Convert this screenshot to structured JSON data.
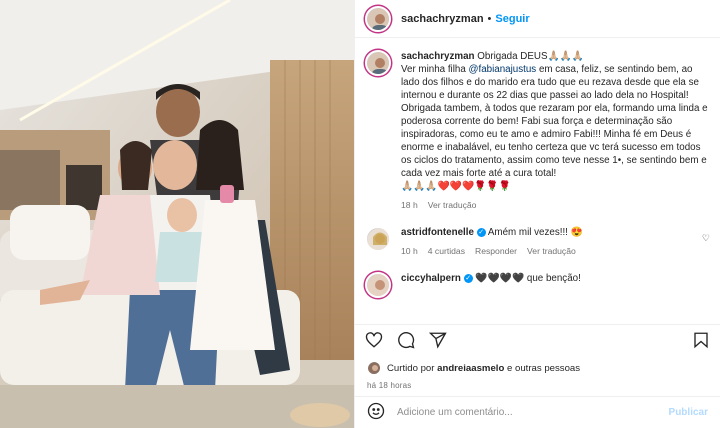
{
  "post": {
    "username": "sachachryzman",
    "separator": "•",
    "follow_label": "Seguir"
  },
  "caption": {
    "username": "sachachryzman",
    "lead": "Obrigada DEUS🙏🏼🙏🏼🙏🏼",
    "p1_before": "Ver minha filha ",
    "mention": "@fabianajustus",
    "p1_after": " em casa, feliz, se sentindo bem, ao lado dos filhos e do marido era tudo que eu rezava desde que ela se internou e durante os 22 dias que passei ao lado dela no Hospital!",
    "p2": "Obrigada tambem, à todos que rezaram por ela, formando uma linda e poderosa corrente do bem! Fabi sua força e determinação são inspiradoras, como eu te amo e admiro Fabi!!! Minha fé em Deus é enorme e inabalável, eu tenho certeza que vc terá sucesso em todos os ciclos do tratamento, assim como teve nesse 1•, se sentindo bem e cada vez mais forte até a cura total!",
    "emojis": "🙏🏼🙏🏼🙏🏼❤️❤️❤️🌹🌹🌹",
    "time": "18 h",
    "translate": "Ver tradução"
  },
  "comments": [
    {
      "username": "astridfontenelle",
      "text": "Amém mil vezes!!! 😍",
      "time": "10 h",
      "likes": "4 curtidas",
      "reply": "Responder",
      "translate": "Ver tradução"
    },
    {
      "username": "ciccyhalpern",
      "text": "🖤🖤🖤🖤 que benção!"
    }
  ],
  "likes": {
    "prefix": "Curtido por ",
    "user": "andreiaasmelo",
    "suffix": " e outras pessoas"
  },
  "posted_ago": "há 18 horas",
  "comment_input": {
    "placeholder": "Adicione um comentário...",
    "post_label": "Publicar"
  },
  "colors": {
    "accent": "#0095f6",
    "text": "#262626",
    "muted": "#737373"
  }
}
